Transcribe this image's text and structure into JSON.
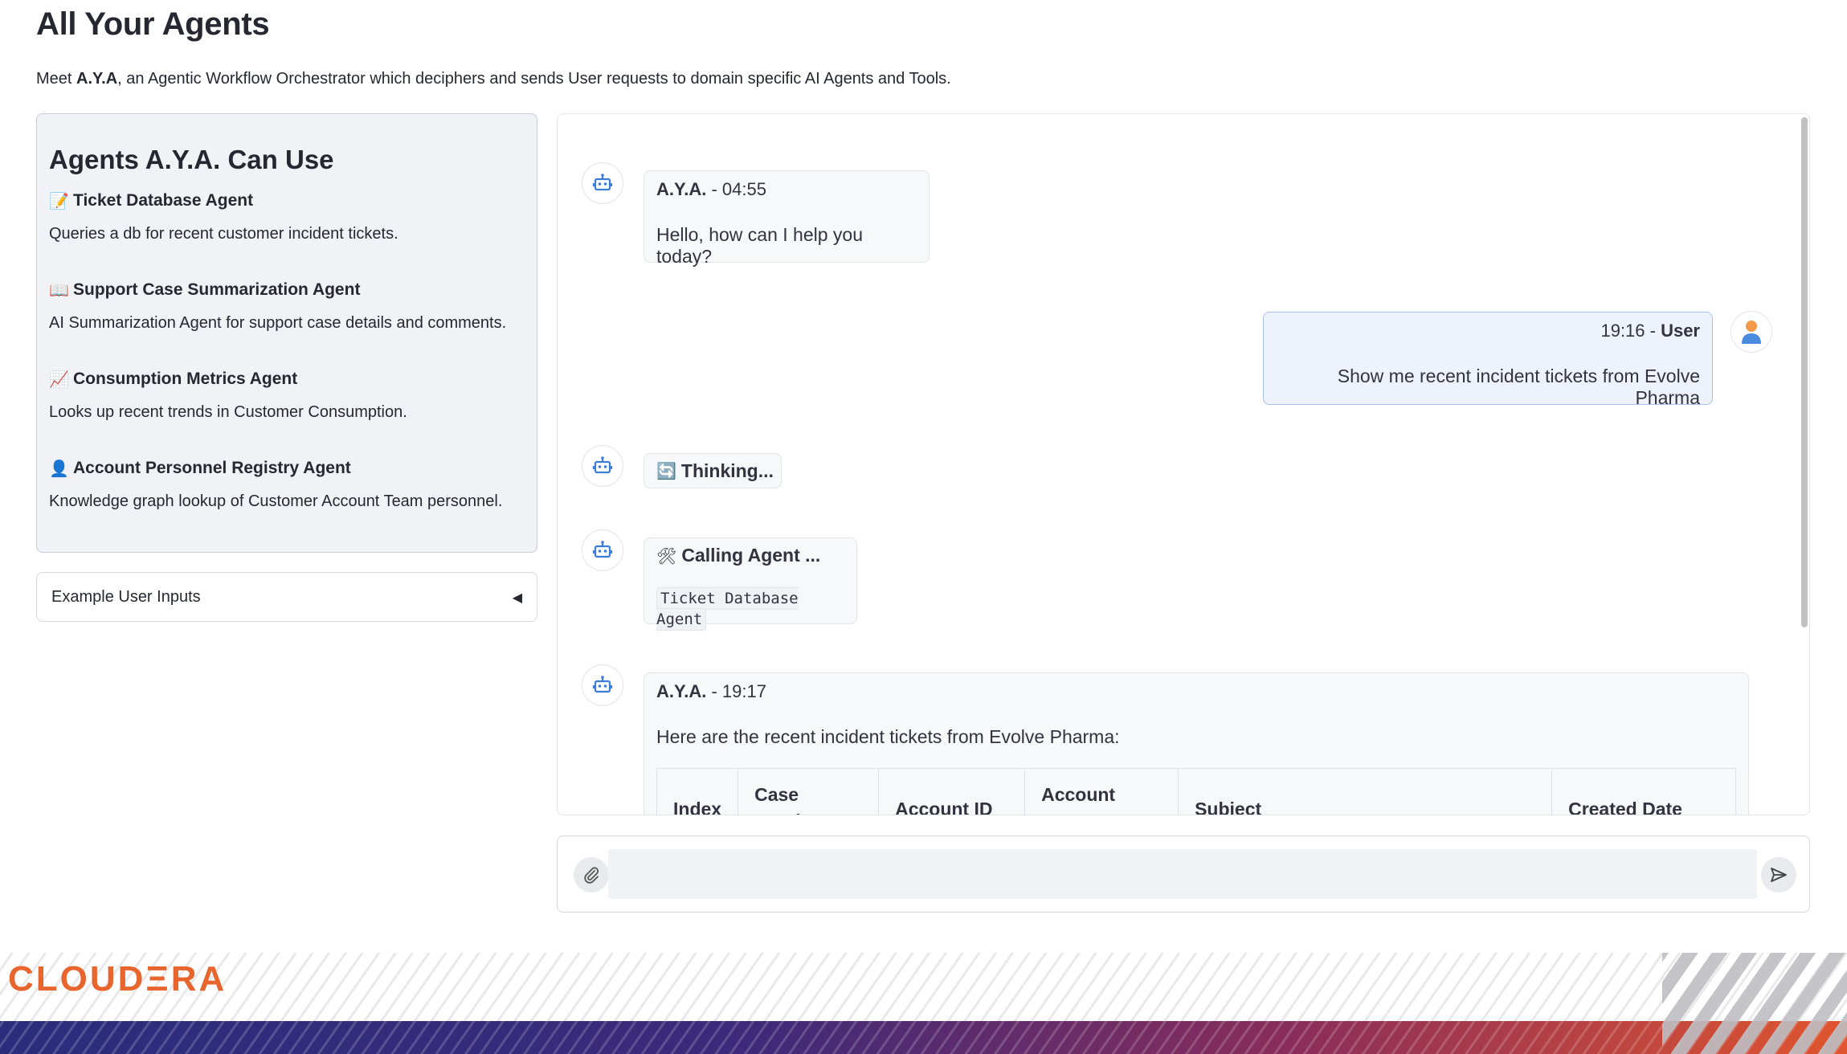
{
  "header": {
    "title": "All Your Agents",
    "desc_prefix": "Meet ",
    "desc_bold": "A.Y.A",
    "desc_suffix": ", an Agentic Workflow Orchestrator which deciphers and sends User requests to domain specific AI Agents and Tools."
  },
  "agents_panel": {
    "title": "Agents A.Y.A. Can Use",
    "agents": [
      {
        "emoji": "📝",
        "icon": "memo-icon",
        "name": "Ticket Database Agent",
        "desc": "Queries a db for recent customer incident tickets."
      },
      {
        "emoji": "📖",
        "icon": "book-icon",
        "name": "Support Case Summarization Agent",
        "desc": "AI Summarization Agent for support case details and comments."
      },
      {
        "emoji": "📈",
        "icon": "chart-increasing-icon",
        "name": "Consumption Metrics Agent",
        "desc": "Looks up recent trends in Customer Consumption."
      },
      {
        "emoji": "👤",
        "icon": "person-icon",
        "name": "Account Personnel Registry Agent",
        "desc": "Knowledge graph lookup of Customer Account Team personnel."
      }
    ]
  },
  "example_inputs": {
    "label": "Example User Inputs",
    "arrow": "◀"
  },
  "chat": {
    "msg1": {
      "sender": "A.Y.A.",
      "time": " - 04:55",
      "text": "Hello, how can I help you today?"
    },
    "msg2": {
      "time": "19:16 - ",
      "sender": "User",
      "text": "Show me recent incident tickets from Evolve Pharma"
    },
    "msg3": {
      "emoji": "🔄",
      "text": "Thinking..."
    },
    "msg4": {
      "emoji": "🛠",
      "text": "Calling Agent ...",
      "code": "Ticket Database Agent"
    },
    "msg5": {
      "sender": "A.Y.A.",
      "time": " - 19:17",
      "text": "Here are the recent incident tickets from Evolve Pharma:",
      "table_headers": [
        "Index",
        "Case Number",
        "Account ID",
        "Account Name",
        "Subject",
        "Created Date"
      ]
    }
  },
  "input": {
    "placeholder": "",
    "value": ""
  },
  "footer": {
    "logo": "CLOUDΞRA"
  },
  "colors": {
    "accent": "#e8652d",
    "bot_icon": "#3b7dd8",
    "user_bubble": "#edf2fb"
  }
}
